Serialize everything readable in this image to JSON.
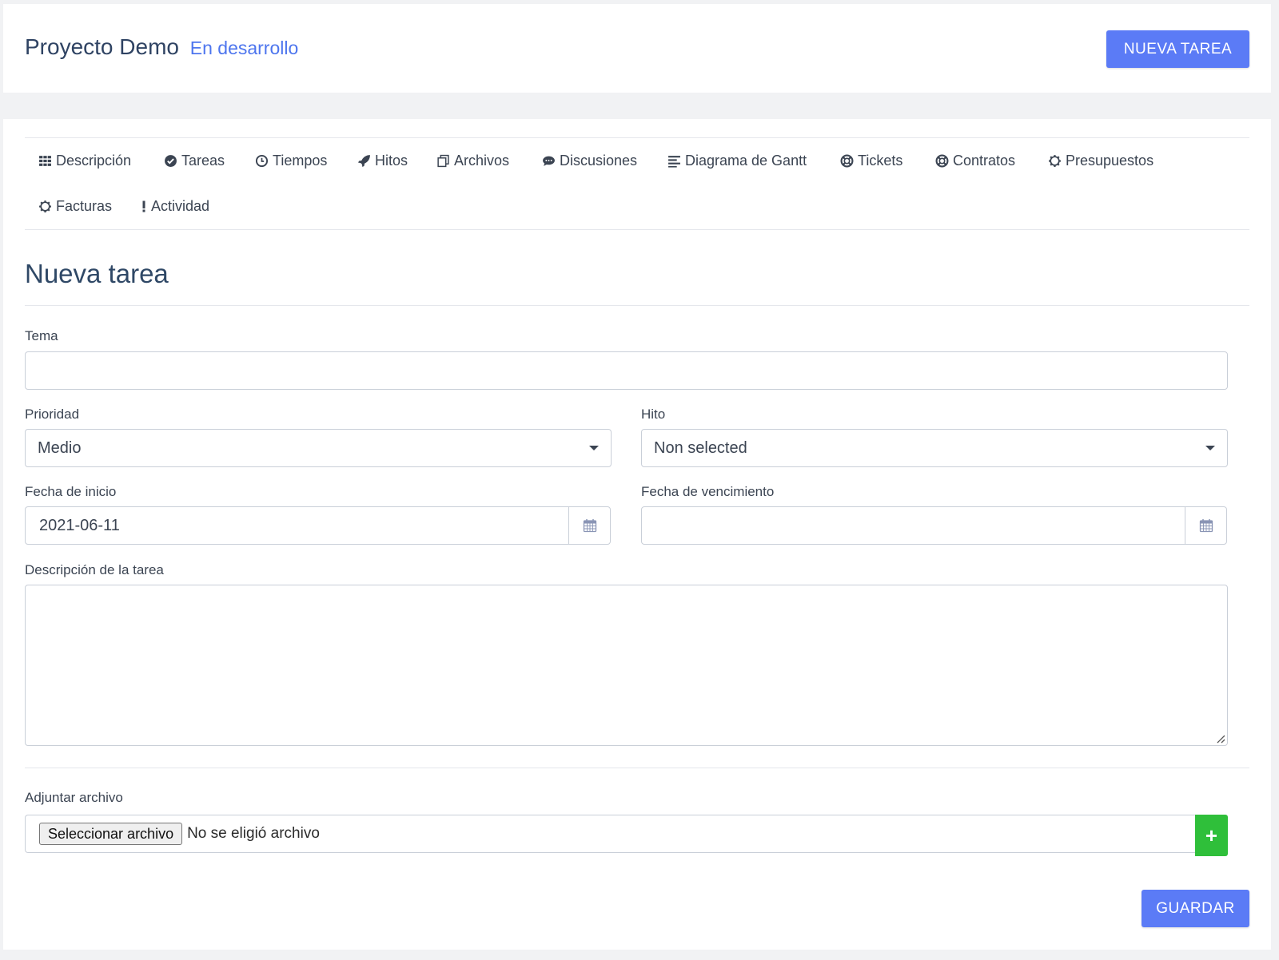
{
  "header": {
    "project_name": "Proyecto Demo",
    "project_status": "En desarrollo",
    "new_task_label": "NUEVA TAREA"
  },
  "tabs": [
    {
      "label": "Descripción",
      "icon": "grid-icon"
    },
    {
      "label": "Tareas",
      "icon": "check-circle-icon"
    },
    {
      "label": "Tiempos",
      "icon": "clock-icon"
    },
    {
      "label": "Hitos",
      "icon": "rocket-icon"
    },
    {
      "label": "Archivos",
      "icon": "files-icon"
    },
    {
      "label": "Discusiones",
      "icon": "comments-icon"
    },
    {
      "label": "Diagrama de Gantt",
      "icon": "align-left-icon"
    },
    {
      "label": "Tickets",
      "icon": "life-ring-icon"
    },
    {
      "label": "Contratos",
      "icon": "life-ring-icon"
    },
    {
      "label": "Presupuestos",
      "icon": "cog-icon"
    },
    {
      "label": "Facturas",
      "icon": "cog-icon"
    },
    {
      "label": "Actividad",
      "icon": "exclamation-icon"
    }
  ],
  "form": {
    "title": "Nueva tarea",
    "subject_label": "Tema",
    "subject_value": "",
    "priority_label": "Prioridad",
    "priority_value": "Medio",
    "milestone_label": "Hito",
    "milestone_value": "Non selected",
    "start_date_label": "Fecha de inicio",
    "start_date_value": "2021-06-11",
    "due_date_label": "Fecha de vencimiento",
    "due_date_value": "",
    "description_label": "Descripción de la tarea",
    "attach_label": "Adjuntar archivo",
    "file_button_label": "Seleccionar archivo",
    "file_status": "No se eligió archivo",
    "add_button_label": "+",
    "save_label": "GUARDAR"
  },
  "colors": {
    "accent": "#5b7bf6",
    "status": "#4d75ee",
    "add_button": "#2fbf3a"
  }
}
